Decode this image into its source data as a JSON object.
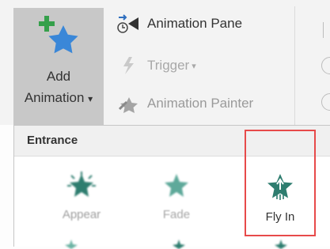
{
  "ribbon": {
    "add_animation": {
      "line1": "Add",
      "line2": "Animation",
      "icon": "add-animation-star-plus-icon"
    },
    "animation_pane": {
      "label": "Animation Pane",
      "icon": "animation-pane-icon"
    },
    "trigger": {
      "label": "Trigger",
      "icon": "lightning-icon",
      "enabled": false
    },
    "animation_painter": {
      "label": "Animation Painter",
      "icon": "animation-painter-icon",
      "enabled": false
    },
    "dropdown_arrow": "▾"
  },
  "gallery": {
    "section_title": "Entrance",
    "effects": [
      {
        "label": "Appear",
        "icon": "appear-star-icon"
      },
      {
        "label": "Fade",
        "icon": "fade-star-icon"
      },
      {
        "label": "Fly In",
        "icon": "fly-in-star-icon",
        "highlighted": true
      }
    ]
  },
  "colors": {
    "accent_teal": "#2e7d6f",
    "star_blue": "#3a87d8",
    "plus_green": "#35a04b",
    "highlight_red": "#e74a4a"
  }
}
